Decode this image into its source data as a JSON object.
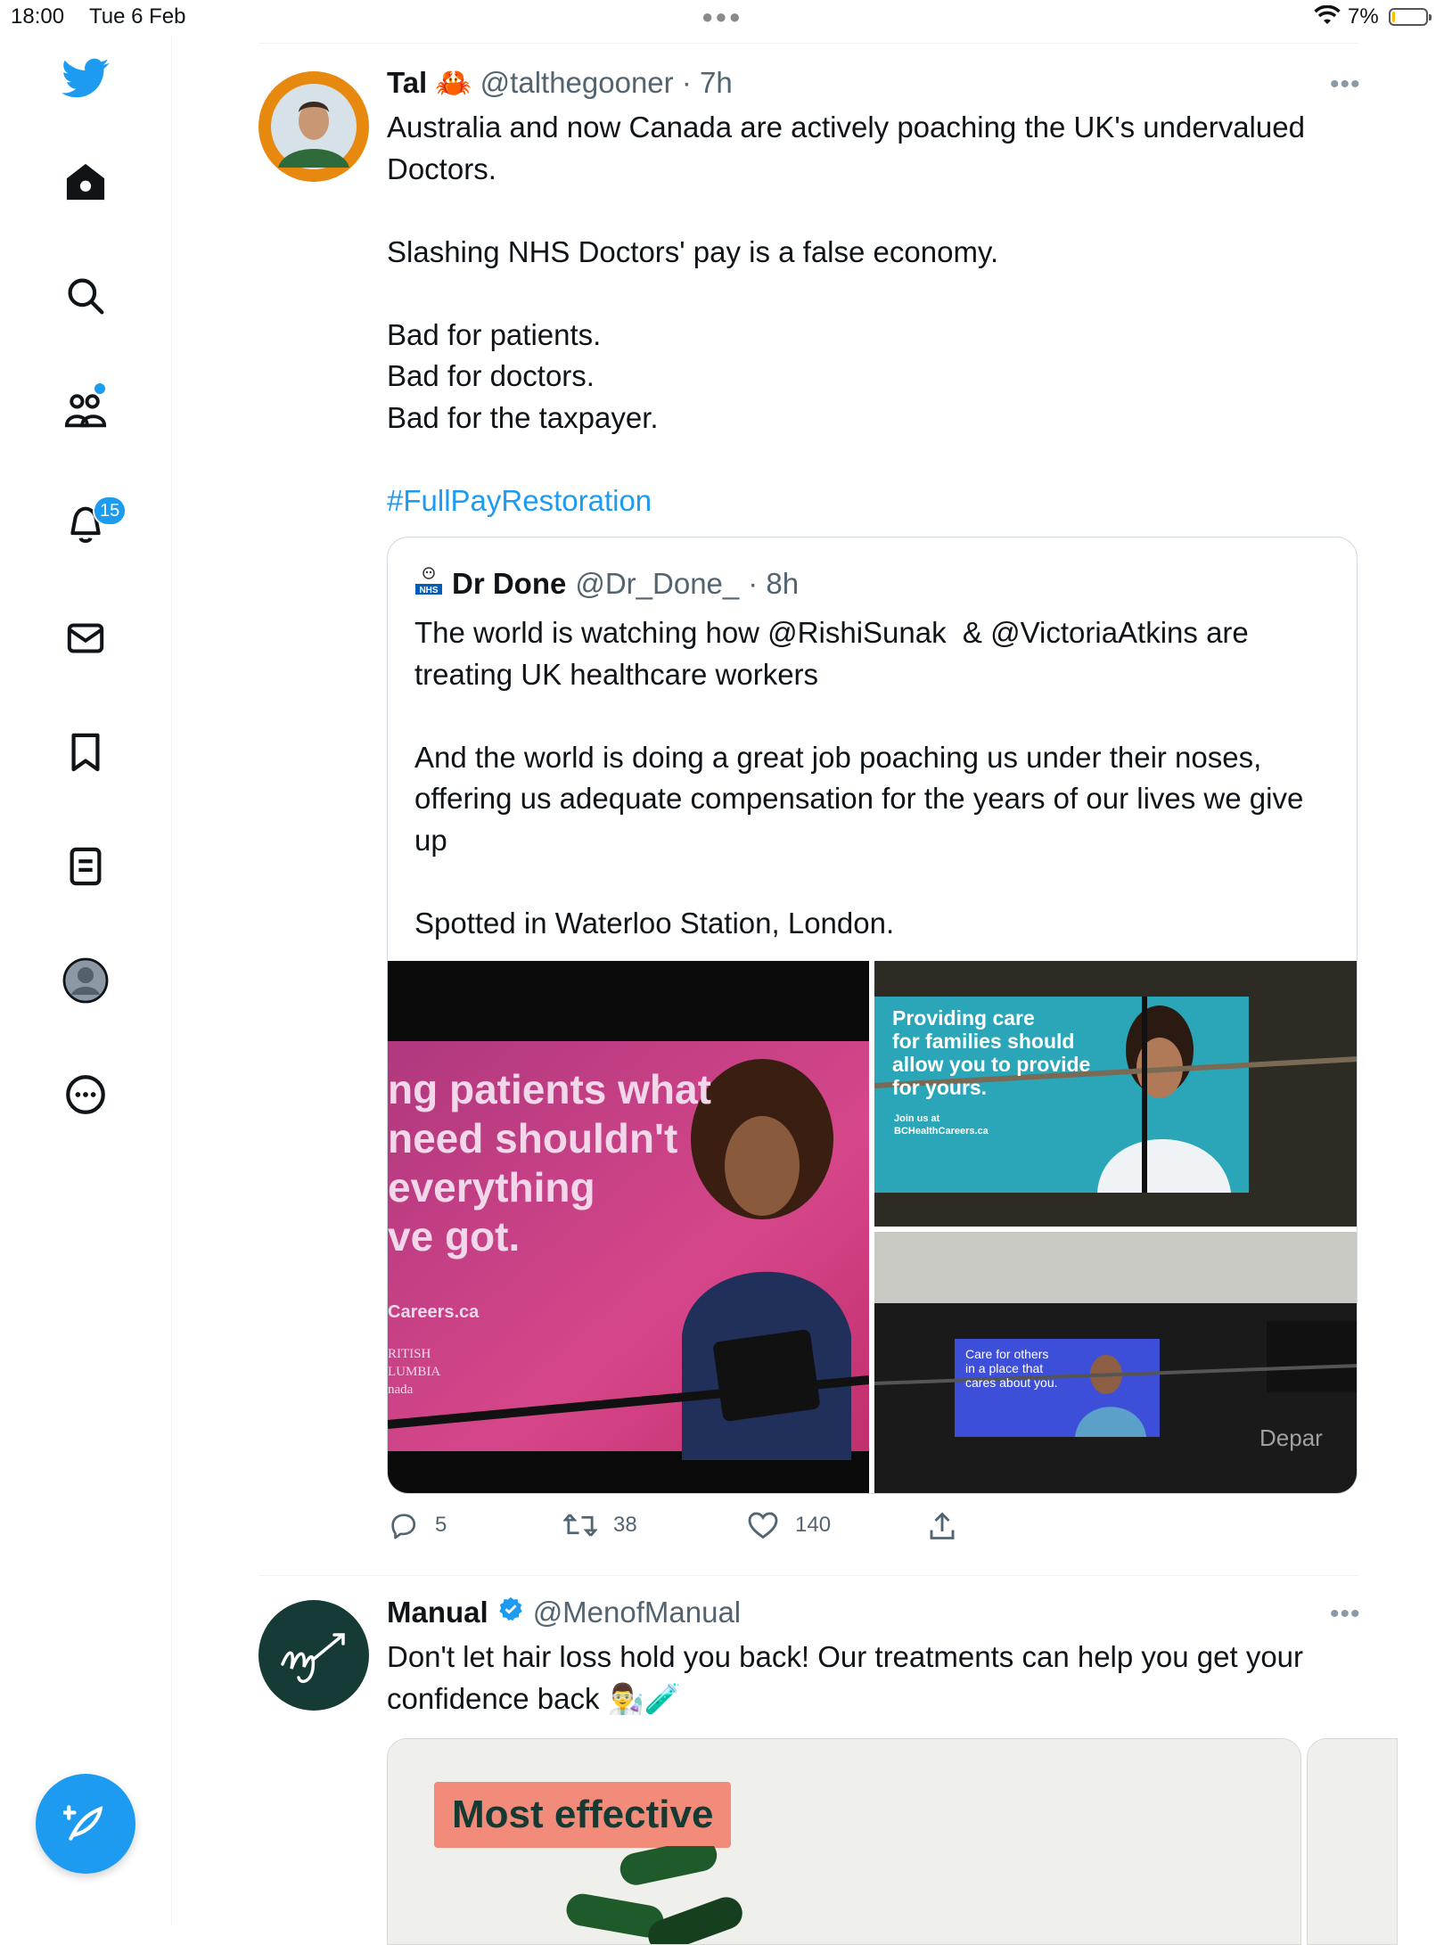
{
  "status_bar": {
    "time": "18:00",
    "date": "Tue 6 Feb",
    "battery_percent": "7%",
    "battery_level": 0.07,
    "battery_color": "#f5c400"
  },
  "sidebar": {
    "items": [
      {
        "icon": "twitter-bird-icon"
      },
      {
        "icon": "home-icon"
      },
      {
        "icon": "search-icon"
      },
      {
        "icon": "communities-icon"
      },
      {
        "icon": "bell-icon",
        "badge": "15"
      },
      {
        "icon": "mail-icon"
      },
      {
        "icon": "bookmark-icon"
      },
      {
        "icon": "list-icon"
      },
      {
        "icon": "profile-icon"
      },
      {
        "icon": "more-icon"
      }
    ],
    "compose_icon": "compose-feather-icon",
    "accent": "#1d9bf0"
  },
  "tweet1": {
    "name": "Tal",
    "name_emoji": "🦀",
    "handle": "@talthegooner",
    "time": "· 7h",
    "text_main": "Australia and now Canada are actively poaching the UK's undervalued Doctors.\n\nSlashing NHS Doctors' pay is a false economy.\n\nBad for patients.\nBad for doctors.\nBad for the taxpayer.\n\n",
    "hashtag": "#FullPayRestoration",
    "quote": {
      "name": "Dr Done",
      "handle": "@Dr_Done_",
      "time": "· 8h",
      "text": "The world is watching how @RishiSunak  & @VictoriaAtkins are treating UK healthcare workers\n\nAnd the world is doing a great job poaching us under their noses, offering us adequate compensation for the years of our lives we give up\n\nSpotted in Waterloo Station, London."
    },
    "images": {
      "img1": {
        "lines": [
          "ng patients what",
          "need shouldn't",
          "everything",
          "ve got."
        ],
        "url_text": "Careers.ca",
        "logo_lines": [
          "RITISH",
          "LUMBIA",
          "nada"
        ]
      },
      "img2": {
        "lines": [
          "Providing care",
          "for families should",
          "allow you to provide",
          "for yours."
        ],
        "small": [
          "Join us at",
          "BCHealthCareers.ca"
        ]
      },
      "img3": {
        "lines": [
          "Care for others",
          "in a place that",
          "cares about you."
        ],
        "board": "Depar"
      }
    },
    "replies": "5",
    "retweets": "38",
    "likes": "140"
  },
  "tweet2": {
    "name": "Manual",
    "handle": "@MenofManual",
    "text": "Don't let hair loss hold you back! Our treatments can help you get your confidence back 👨‍🔬🧪",
    "ad_label": "Most effective"
  }
}
